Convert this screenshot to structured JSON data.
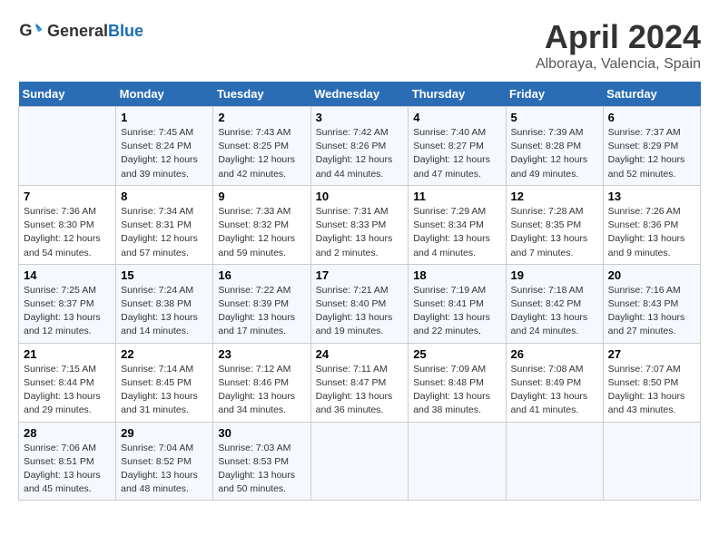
{
  "header": {
    "logo_general": "General",
    "logo_blue": "Blue",
    "title": "April 2024",
    "location": "Alboraya, Valencia, Spain"
  },
  "days_of_week": [
    "Sunday",
    "Monday",
    "Tuesday",
    "Wednesday",
    "Thursday",
    "Friday",
    "Saturday"
  ],
  "weeks": [
    [
      {
        "day": "",
        "info": ""
      },
      {
        "day": "1",
        "info": "Sunrise: 7:45 AM\nSunset: 8:24 PM\nDaylight: 12 hours\nand 39 minutes."
      },
      {
        "day": "2",
        "info": "Sunrise: 7:43 AM\nSunset: 8:25 PM\nDaylight: 12 hours\nand 42 minutes."
      },
      {
        "day": "3",
        "info": "Sunrise: 7:42 AM\nSunset: 8:26 PM\nDaylight: 12 hours\nand 44 minutes."
      },
      {
        "day": "4",
        "info": "Sunrise: 7:40 AM\nSunset: 8:27 PM\nDaylight: 12 hours\nand 47 minutes."
      },
      {
        "day": "5",
        "info": "Sunrise: 7:39 AM\nSunset: 8:28 PM\nDaylight: 12 hours\nand 49 minutes."
      },
      {
        "day": "6",
        "info": "Sunrise: 7:37 AM\nSunset: 8:29 PM\nDaylight: 12 hours\nand 52 minutes."
      }
    ],
    [
      {
        "day": "7",
        "info": "Sunrise: 7:36 AM\nSunset: 8:30 PM\nDaylight: 12 hours\nand 54 minutes."
      },
      {
        "day": "8",
        "info": "Sunrise: 7:34 AM\nSunset: 8:31 PM\nDaylight: 12 hours\nand 57 minutes."
      },
      {
        "day": "9",
        "info": "Sunrise: 7:33 AM\nSunset: 8:32 PM\nDaylight: 12 hours\nand 59 minutes."
      },
      {
        "day": "10",
        "info": "Sunrise: 7:31 AM\nSunset: 8:33 PM\nDaylight: 13 hours\nand 2 minutes."
      },
      {
        "day": "11",
        "info": "Sunrise: 7:29 AM\nSunset: 8:34 PM\nDaylight: 13 hours\nand 4 minutes."
      },
      {
        "day": "12",
        "info": "Sunrise: 7:28 AM\nSunset: 8:35 PM\nDaylight: 13 hours\nand 7 minutes."
      },
      {
        "day": "13",
        "info": "Sunrise: 7:26 AM\nSunset: 8:36 PM\nDaylight: 13 hours\nand 9 minutes."
      }
    ],
    [
      {
        "day": "14",
        "info": "Sunrise: 7:25 AM\nSunset: 8:37 PM\nDaylight: 13 hours\nand 12 minutes."
      },
      {
        "day": "15",
        "info": "Sunrise: 7:24 AM\nSunset: 8:38 PM\nDaylight: 13 hours\nand 14 minutes."
      },
      {
        "day": "16",
        "info": "Sunrise: 7:22 AM\nSunset: 8:39 PM\nDaylight: 13 hours\nand 17 minutes."
      },
      {
        "day": "17",
        "info": "Sunrise: 7:21 AM\nSunset: 8:40 PM\nDaylight: 13 hours\nand 19 minutes."
      },
      {
        "day": "18",
        "info": "Sunrise: 7:19 AM\nSunset: 8:41 PM\nDaylight: 13 hours\nand 22 minutes."
      },
      {
        "day": "19",
        "info": "Sunrise: 7:18 AM\nSunset: 8:42 PM\nDaylight: 13 hours\nand 24 minutes."
      },
      {
        "day": "20",
        "info": "Sunrise: 7:16 AM\nSunset: 8:43 PM\nDaylight: 13 hours\nand 27 minutes."
      }
    ],
    [
      {
        "day": "21",
        "info": "Sunrise: 7:15 AM\nSunset: 8:44 PM\nDaylight: 13 hours\nand 29 minutes."
      },
      {
        "day": "22",
        "info": "Sunrise: 7:14 AM\nSunset: 8:45 PM\nDaylight: 13 hours\nand 31 minutes."
      },
      {
        "day": "23",
        "info": "Sunrise: 7:12 AM\nSunset: 8:46 PM\nDaylight: 13 hours\nand 34 minutes."
      },
      {
        "day": "24",
        "info": "Sunrise: 7:11 AM\nSunset: 8:47 PM\nDaylight: 13 hours\nand 36 minutes."
      },
      {
        "day": "25",
        "info": "Sunrise: 7:09 AM\nSunset: 8:48 PM\nDaylight: 13 hours\nand 38 minutes."
      },
      {
        "day": "26",
        "info": "Sunrise: 7:08 AM\nSunset: 8:49 PM\nDaylight: 13 hours\nand 41 minutes."
      },
      {
        "day": "27",
        "info": "Sunrise: 7:07 AM\nSunset: 8:50 PM\nDaylight: 13 hours\nand 43 minutes."
      }
    ],
    [
      {
        "day": "28",
        "info": "Sunrise: 7:06 AM\nSunset: 8:51 PM\nDaylight: 13 hours\nand 45 minutes."
      },
      {
        "day": "29",
        "info": "Sunrise: 7:04 AM\nSunset: 8:52 PM\nDaylight: 13 hours\nand 48 minutes."
      },
      {
        "day": "30",
        "info": "Sunrise: 7:03 AM\nSunset: 8:53 PM\nDaylight: 13 hours\nand 50 minutes."
      },
      {
        "day": "",
        "info": ""
      },
      {
        "day": "",
        "info": ""
      },
      {
        "day": "",
        "info": ""
      },
      {
        "day": "",
        "info": ""
      }
    ]
  ]
}
